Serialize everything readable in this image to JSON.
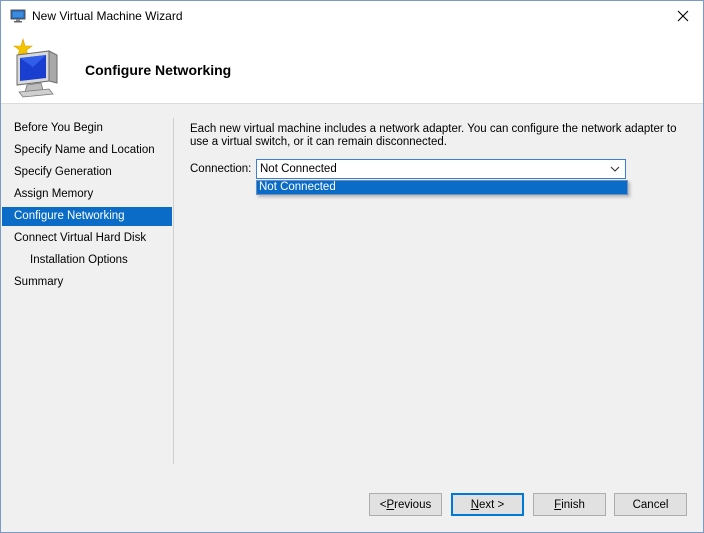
{
  "window": {
    "title": "New Virtual Machine Wizard"
  },
  "header": {
    "title": "Configure Networking"
  },
  "nav": {
    "items": [
      {
        "label": "Before You Begin",
        "active": false,
        "sub": false
      },
      {
        "label": "Specify Name and Location",
        "active": false,
        "sub": false
      },
      {
        "label": "Specify Generation",
        "active": false,
        "sub": false
      },
      {
        "label": "Assign Memory",
        "active": false,
        "sub": false
      },
      {
        "label": "Configure Networking",
        "active": true,
        "sub": false
      },
      {
        "label": "Connect Virtual Hard Disk",
        "active": false,
        "sub": false
      },
      {
        "label": "Installation Options",
        "active": false,
        "sub": true
      },
      {
        "label": "Summary",
        "active": false,
        "sub": false
      }
    ]
  },
  "content": {
    "description": "Each new virtual machine includes a network adapter. You can configure the network adapter to use a virtual switch, or it can remain disconnected.",
    "connection_label": "Connection:",
    "connection_value": "Not Connected",
    "dropdown_options": [
      "Not Connected"
    ]
  },
  "buttons": {
    "previous_prefix": "< ",
    "previous_mnemonic": "P",
    "previous_rest": "revious",
    "next_mnemonic": "N",
    "next_rest": "ext >",
    "finish_mnemonic": "F",
    "finish_rest": "inish",
    "cancel": "Cancel"
  },
  "colors": {
    "accent": "#0a6cc6",
    "dialog_bg": "#f0f0f0"
  }
}
